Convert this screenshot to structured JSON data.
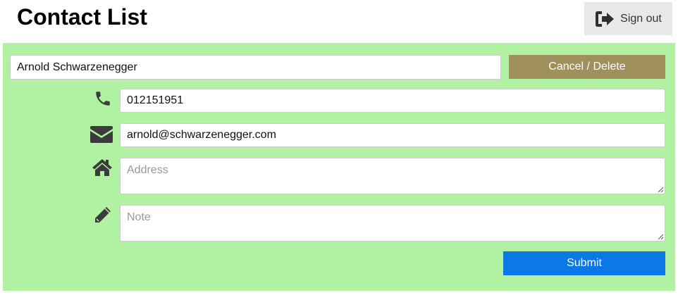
{
  "header": {
    "title": "Contact List",
    "sign_out_label": "Sign out"
  },
  "form": {
    "name_value": "Arnold Schwarzenegger",
    "cancel_delete_label": "Cancel / Delete",
    "phone_value": "012151951",
    "email_value": "arnold@schwarzenegger.com",
    "address_placeholder": "Address",
    "note_placeholder": "Note",
    "submit_label": "Submit"
  },
  "icons": {
    "phone": "phone-icon",
    "email": "envelope-icon",
    "address": "home-icon",
    "note": "pencil-icon",
    "signout": "sign-out-icon"
  },
  "colors": {
    "panel_bg": "#b0f2a2",
    "cancel_bg": "#a0905c",
    "submit_bg": "#0a78e6",
    "signout_bg": "#e8e8e8"
  }
}
